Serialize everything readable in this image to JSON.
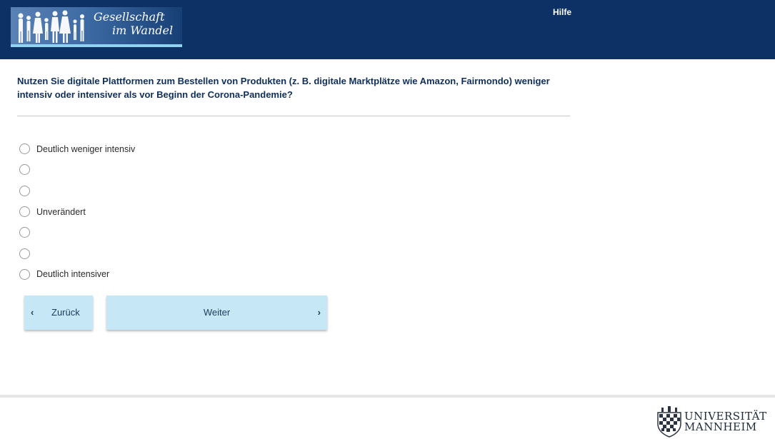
{
  "header": {
    "logo_line1": "Gesellschaft",
    "logo_line2": "im Wandel",
    "help_label": "Hilfe",
    "color": "#0d3165"
  },
  "question": {
    "text": "Nutzen Sie digitale Plattformen zum Bestellen von Produkten (z. B. digitale Marktplätze wie Amazon, Fairmondo) weniger intensiv oder intensiver als vor Beginn der Corona-Pandemie?"
  },
  "options": [
    {
      "label": "Deutlich weniger intensiv"
    },
    {
      "label": ""
    },
    {
      "label": ""
    },
    {
      "label": "Unverändert"
    },
    {
      "label": ""
    },
    {
      "label": ""
    },
    {
      "label": "Deutlich intensiver"
    }
  ],
  "nav": {
    "back_label": "Zurück",
    "next_label": "Weiter",
    "button_color": "#c6e8f6"
  },
  "footer": {
    "university_line1": "UNIVERSITÄT",
    "university_line2": "MANNHEIM"
  }
}
